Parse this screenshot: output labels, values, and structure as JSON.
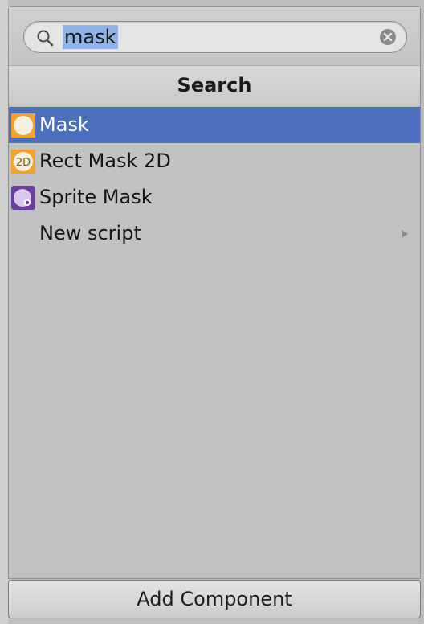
{
  "search": {
    "query": "mask",
    "placeholder": ""
  },
  "header": {
    "title": "Search"
  },
  "results": [
    {
      "label": "Mask",
      "icon": "mask-icon",
      "selected": true
    },
    {
      "label": "Rect Mask 2D",
      "icon": "rect-mask-2d-icon",
      "icon_text": "2D",
      "selected": false
    },
    {
      "label": "Sprite Mask",
      "icon": "sprite-mask-icon",
      "selected": false
    },
    {
      "label": "New script",
      "icon": "",
      "has_submenu": true,
      "selected": false
    }
  ],
  "footer": {
    "button_label": "Add Component"
  },
  "colors": {
    "selection": "#4b6fbd",
    "text_highlight": "#8fb3e8",
    "mask_icon": "#f3a32b",
    "sprite_mask_icon": "#6b3fa0"
  }
}
